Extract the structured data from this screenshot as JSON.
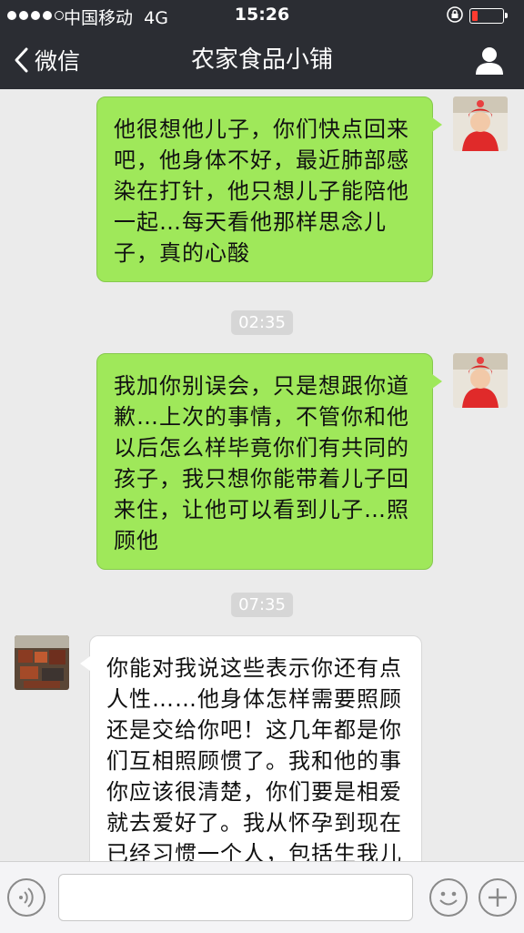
{
  "status_bar": {
    "carrier": "中国移动",
    "network": "4G",
    "time": "15:26"
  },
  "nav": {
    "back_label": "微信",
    "title": "农家食品小铺"
  },
  "messages": [
    {
      "from": "me",
      "text": "他很想他儿子，你们快点回来吧，他身体不好，最近肺部感染在打针，他只想儿子能陪他一起…每天看他那样思念儿子，真的心酸"
    },
    {
      "type": "time",
      "text": "02:35"
    },
    {
      "from": "me",
      "text": "我加你别误会，只是想跟你道歉…上次的事情，不管你和他以后怎么样毕竟你们有共同的孩子，我只想你能带着儿子回来住，让他可以看到儿子…照顾他"
    },
    {
      "type": "time",
      "text": "07:35"
    },
    {
      "from": "them",
      "text": "你能对我说这些表示你还有点人性……他身体怎样需要照顾还是交给你吧！这几年都是你们互相照顾惯了。我和他的事你应该很清楚，你们要是相爱就去爱好了。我从怀孕到现在已经习惯一个人，包括生我儿子也都只有我妈在外面等着"
    }
  ],
  "input": {
    "value": ""
  },
  "icons": {
    "back": "chevron-left-icon",
    "profile": "person-icon",
    "voice": "voice-icon",
    "emoji": "emoji-icon",
    "plus": "plus-icon"
  },
  "colors": {
    "bar": "#2b2d33",
    "my_bubble": "#9fe85a",
    "their_bubble": "#ffffff",
    "chat_bg": "#ebebeb"
  }
}
